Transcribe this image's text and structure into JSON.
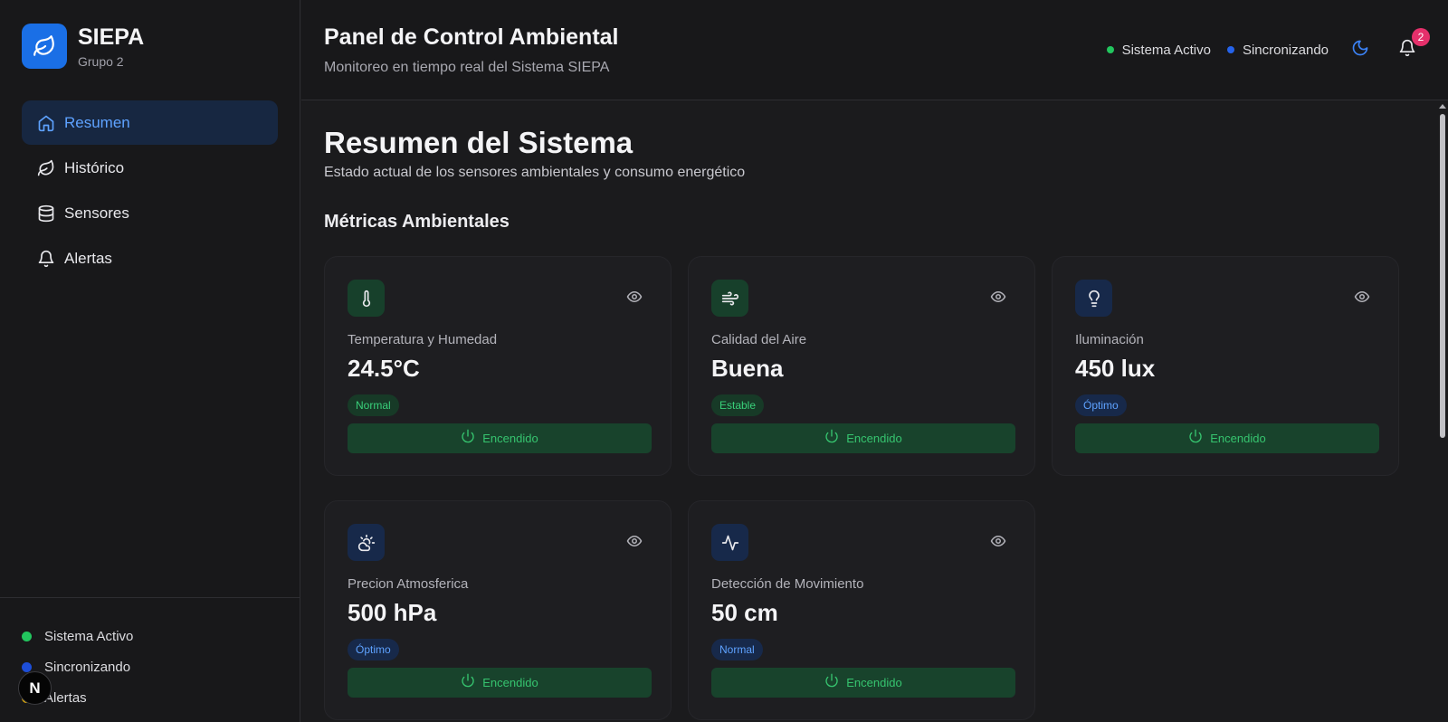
{
  "brand": {
    "name": "SIEPA",
    "subtitle": "Grupo 2",
    "logo_icon": "leaf-icon",
    "color": "#1a6fe6"
  },
  "nav": {
    "items": [
      {
        "label": "Resumen",
        "icon": "home-icon",
        "active": true
      },
      {
        "label": "Histórico",
        "icon": "leaf-icon",
        "active": false
      },
      {
        "label": "Sensores",
        "icon": "database-icon",
        "active": false
      },
      {
        "label": "Alertas",
        "icon": "bell-icon",
        "active": false
      }
    ]
  },
  "sidebar_status": [
    {
      "label": "Sistema Activo",
      "color": "#22c55e"
    },
    {
      "label": "Sincronizando",
      "color": "#1d4ed8"
    },
    {
      "label": "Alertas",
      "color": "#eab308"
    }
  ],
  "header": {
    "title": "Panel de Control Ambiental",
    "subtitle": "Monitoreo en tiempo real del Sistema SIEPA",
    "status": [
      {
        "label": "Sistema Activo",
        "color": "#22c55e"
      },
      {
        "label": "Sincronizando",
        "color": "#2563eb"
      }
    ],
    "theme_icon": "moon-icon",
    "notifications_count": "2"
  },
  "main": {
    "title": "Resumen del Sistema",
    "subtitle": "Estado actual de los sensores ambientales y consumo energético",
    "section_title": "Métricas Ambientales",
    "cards": [
      {
        "label": "Temperatura y Humedad",
        "value": "24.5°C",
        "badge": "Normal",
        "badge_tone": "green",
        "icon": "thermometer-icon",
        "icon_tone": "green",
        "button": "Encendido"
      },
      {
        "label": "Calidad del Aire",
        "value": "Buena",
        "badge": "Estable",
        "badge_tone": "green",
        "icon": "wind-icon",
        "icon_tone": "green",
        "button": "Encendido"
      },
      {
        "label": "Iluminación",
        "value": "450 lux",
        "badge": "Óptimo",
        "badge_tone": "blue",
        "icon": "lightbulb-icon",
        "icon_tone": "blue",
        "button": "Encendido"
      },
      {
        "label": "Precion Atmosferica",
        "value": "500 hPa",
        "badge": "Óptimo",
        "badge_tone": "blue",
        "icon": "cloud-sun-icon",
        "icon_tone": "blue",
        "button": "Encendido"
      },
      {
        "label": "Detección de Movimiento",
        "value": "50 cm",
        "badge": "Normal",
        "badge_tone": "blue",
        "icon": "activity-icon",
        "icon_tone": "blue",
        "button": "Encendido"
      }
    ]
  },
  "dev_badge": {
    "label": "N"
  }
}
